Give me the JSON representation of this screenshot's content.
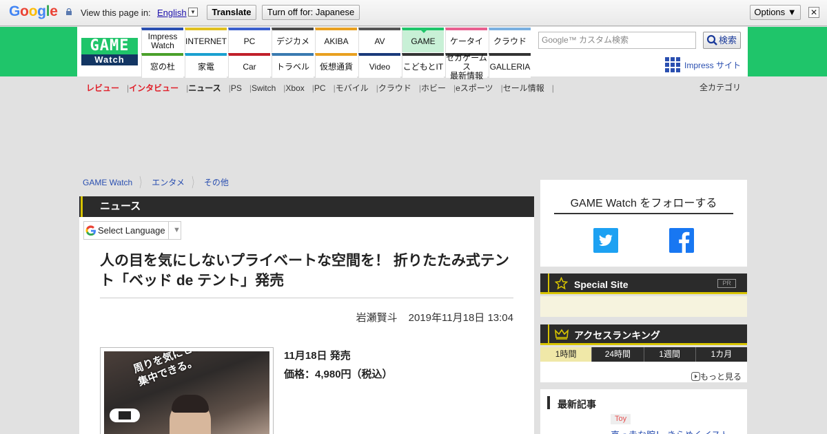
{
  "translate_bar": {
    "logo": "Google",
    "view_text": "View this page in:",
    "language": "English",
    "translate_button": "Translate",
    "turn_off_button": "Turn off for: Japanese",
    "options_button": "Options ▼",
    "close": "✕"
  },
  "header": {
    "logo_top": "GAME",
    "logo_bottom": "Watch",
    "nav_top": [
      {
        "label": "Impress\nWatch",
        "color": "#2a4fb0"
      },
      {
        "label": "INTERNET",
        "color": "#e0c020"
      },
      {
        "label": "PC",
        "color": "#3a5fcd"
      },
      {
        "label": "デジカメ",
        "color": "#4a4a4a"
      },
      {
        "label": "AKIBA",
        "color": "#e8a020"
      },
      {
        "label": "AV",
        "color": "#555555"
      },
      {
        "label": "GAME",
        "color": "#1fc56a"
      },
      {
        "label": "ケータイ",
        "color": "#e86090"
      },
      {
        "label": "クラウド",
        "color": "#7ab0e0"
      }
    ],
    "nav_bottom": [
      {
        "label": "窓の杜",
        "color": "#4aa02a"
      },
      {
        "label": "家電",
        "color": "#1aa0d0"
      },
      {
        "label": "Car",
        "color": "#c0202a"
      },
      {
        "label": "トラベル",
        "color": "#3a7ab0"
      },
      {
        "label": "仮想通貨",
        "color": "#e8a020"
      },
      {
        "label": "Video",
        "color": "#1a3a7a"
      },
      {
        "label": "こどもとIT",
        "color": "#333333"
      },
      {
        "label": "セガゲームス\n最新情報",
        "color": "#333333"
      },
      {
        "label": "GALLERIA",
        "color": "#333333"
      }
    ],
    "search_placeholder": "Google™ カスタム検索",
    "search_button": "検索",
    "impress_site": "Impress サイト"
  },
  "subnav": {
    "items": [
      {
        "label": "レビュー",
        "style": "red"
      },
      {
        "label": "インタビュー",
        "style": "red"
      },
      {
        "label": "ニュース",
        "style": "bold"
      },
      {
        "label": "PS",
        "style": "normal"
      },
      {
        "label": "Switch",
        "style": "normal"
      },
      {
        "label": "Xbox",
        "style": "normal"
      },
      {
        "label": "PC",
        "style": "normal"
      },
      {
        "label": "モバイル",
        "style": "normal"
      },
      {
        "label": "クラウド",
        "style": "normal"
      },
      {
        "label": "ホビー",
        "style": "normal"
      },
      {
        "label": "eスポーツ",
        "style": "normal"
      },
      {
        "label": "セール情報",
        "style": "normal"
      }
    ],
    "all_categories": "全カテゴリ"
  },
  "breadcrumb": [
    "GAME Watch",
    "エンタメ",
    "その他"
  ],
  "article": {
    "section": "ニュース",
    "select_language": "Select Language",
    "title": "人の目を気にしないプライベートな空間を！ 折りたたみ式テント「ベッド de テント」発売",
    "author": "岩瀬賢斗",
    "date": "2019年11月18日 13:04",
    "photo_caption": "周りを気にせずゲームや作業に集中できる。",
    "release_line": "11月18日 発売",
    "price_line": "価格：4,980円（税込）"
  },
  "sidebar": {
    "follow_title": "GAME Watch をフォローする",
    "special_site": "Special Site",
    "pr": "PR",
    "access_ranking": "アクセスランキング",
    "tabs": [
      "1時間",
      "24時間",
      "1週間",
      "1カ月"
    ],
    "more": "もっと見る",
    "latest_title": "最新記事",
    "latest_tag": "Toy",
    "latest_item": "真っ赤な腕！ きらめくイスト"
  },
  "colors": {
    "brand_green": "#1fc56a",
    "dark": "#2b2b2b",
    "accent_yellow": "#d8c400"
  }
}
